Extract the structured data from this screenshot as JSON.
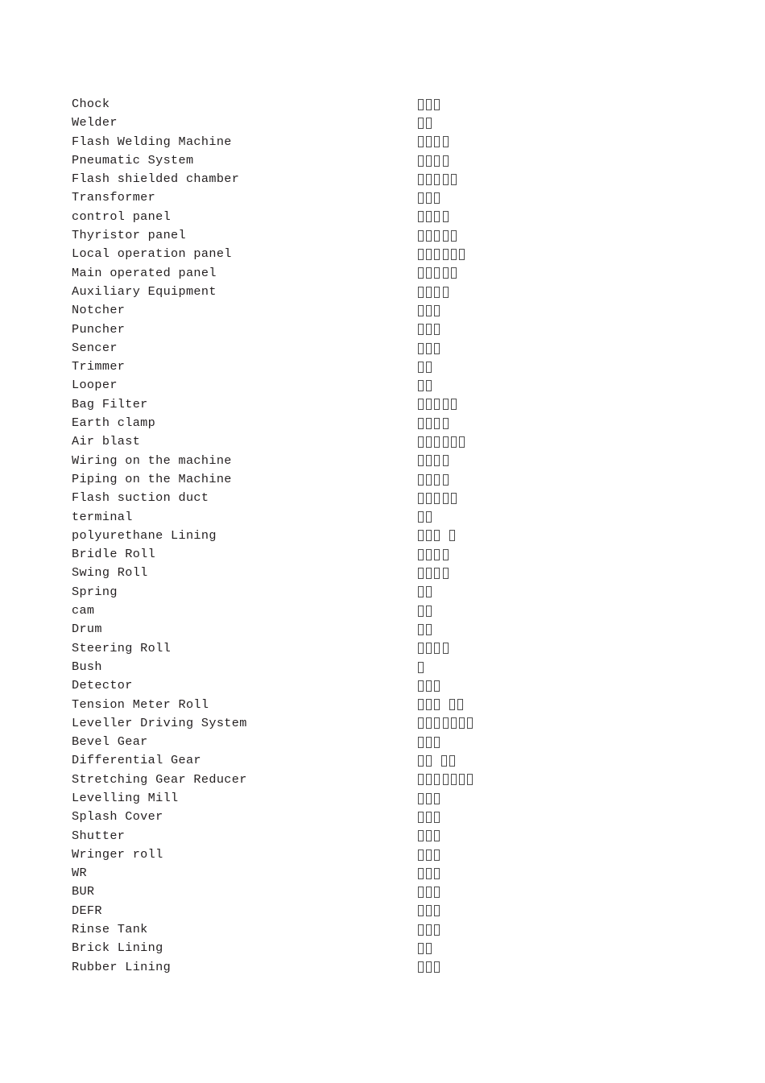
{
  "document": {
    "type": "bilingual-glossary",
    "page_background": "#ffffff",
    "text_color": "#231f20",
    "note": "Right-hand column characters render as missing-glyph (tofu) boxes",
    "columns": {
      "left_header": "",
      "right_header": ""
    }
  },
  "entries": [
    {
      "en": "Chock",
      "cjk_boxes": [
        3
      ]
    },
    {
      "en": "Welder",
      "cjk_boxes": [
        2
      ]
    },
    {
      "en": "Flash Welding Machine",
      "cjk_boxes": [
        4
      ]
    },
    {
      "en": "Pneumatic System",
      "cjk_boxes": [
        4
      ]
    },
    {
      "en": "Flash shielded chamber",
      "cjk_boxes": [
        5
      ]
    },
    {
      "en": "Transformer",
      "cjk_boxes": [
        3
      ]
    },
    {
      "en": "control panel",
      "cjk_boxes": [
        4
      ]
    },
    {
      "en": "Thyristor panel",
      "cjk_boxes": [
        5
      ]
    },
    {
      "en": "Local operation panel",
      "cjk_boxes": [
        6
      ]
    },
    {
      "en": "Main operated panel",
      "cjk_boxes": [
        5
      ]
    },
    {
      "en": "Auxiliary Equipment",
      "cjk_boxes": [
        4
      ]
    },
    {
      "en": "Notcher",
      "cjk_boxes": [
        3
      ]
    },
    {
      "en": "Puncher",
      "cjk_boxes": [
        3
      ]
    },
    {
      "en": "Sencer",
      "cjk_boxes": [
        3
      ]
    },
    {
      "en": "Trimmer",
      "cjk_boxes": [
        2
      ]
    },
    {
      "en": "Looper",
      "cjk_boxes": [
        2
      ]
    },
    {
      "en": "Bag Filter",
      "cjk_boxes": [
        5
      ]
    },
    {
      "en": "Earth clamp",
      "cjk_boxes": [
        4
      ]
    },
    {
      "en": "Air blast",
      "cjk_boxes": [
        6
      ]
    },
    {
      "en": "Wiring on the machine",
      "cjk_boxes": [
        4
      ]
    },
    {
      "en": "Piping on the Machine",
      "cjk_boxes": [
        4
      ]
    },
    {
      "en": "Flash suction duct",
      "cjk_boxes": [
        5
      ]
    },
    {
      "en": "terminal",
      "cjk_boxes": [
        2
      ]
    },
    {
      "en": "polyurethane Lining",
      "cjk_boxes": [
        3,
        1
      ]
    },
    {
      "en": "Bridle Roll",
      "cjk_boxes": [
        4
      ]
    },
    {
      "en": "Swing Roll",
      "cjk_boxes": [
        4
      ]
    },
    {
      "en": "Spring",
      "cjk_boxes": [
        2
      ]
    },
    {
      "en": "cam",
      "cjk_boxes": [
        2
      ]
    },
    {
      "en": "Drum",
      "cjk_boxes": [
        2
      ]
    },
    {
      "en": "Steering Roll",
      "cjk_boxes": [
        4
      ]
    },
    {
      "en": "Bush",
      "cjk_boxes": [
        1
      ]
    },
    {
      "en": "Detector",
      "cjk_boxes": [
        3
      ]
    },
    {
      "en": "Tension Meter Roll",
      "cjk_boxes": [
        3,
        2
      ]
    },
    {
      "en": "Leveller Driving System",
      "cjk_boxes": [
        7
      ]
    },
    {
      "en": "Bevel Gear",
      "cjk_boxes": [
        3
      ]
    },
    {
      "en": "Differential Gear",
      "cjk_boxes": [
        2,
        2
      ]
    },
    {
      "en": "Stretching Gear Reducer",
      "cjk_boxes": [
        7
      ]
    },
    {
      "en": "Levelling Mill",
      "cjk_boxes": [
        3
      ]
    },
    {
      "en": "Splash Cover",
      "cjk_boxes": [
        3
      ]
    },
    {
      "en": "Shutter",
      "cjk_boxes": [
        3
      ]
    },
    {
      "en": "Wringer roll",
      "cjk_boxes": [
        3
      ]
    },
    {
      "en": "WR",
      "cjk_boxes": [
        3
      ]
    },
    {
      "en": "BUR",
      "cjk_boxes": [
        3
      ]
    },
    {
      "en": "DEFR",
      "cjk_boxes": [
        3
      ]
    },
    {
      "en": "Rinse Tank",
      "cjk_boxes": [
        3
      ]
    },
    {
      "en": "Brick Lining",
      "cjk_boxes": [
        2
      ]
    },
    {
      "en": "Rubber Lining",
      "cjk_boxes": [
        3
      ]
    }
  ]
}
